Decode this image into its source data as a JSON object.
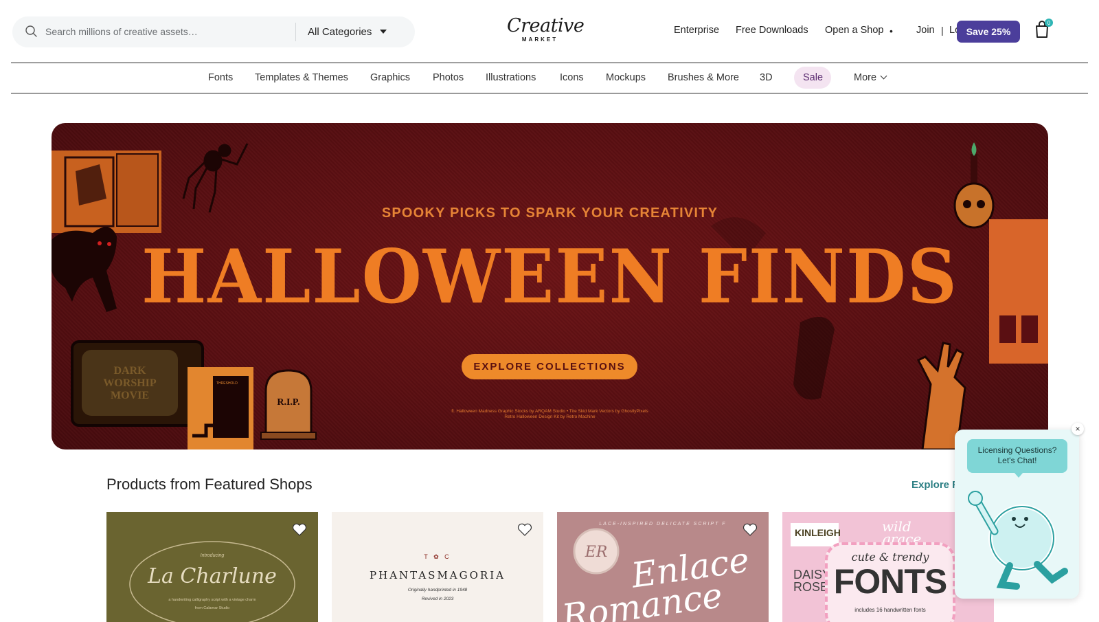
{
  "search": {
    "placeholder": "Search millions of creative assets…",
    "category": "All Categories"
  },
  "logo": {
    "main": "Creative",
    "sub": "MARKET"
  },
  "topnav": {
    "enterprise": "Enterprise",
    "free_downloads": "Free Downloads",
    "open_shop": "Open a Shop",
    "dot": "•",
    "join": "Join",
    "separator": "|",
    "login": "Log in",
    "save": "Save 25%",
    "cart_count": "0"
  },
  "categories": {
    "fonts": "Fonts",
    "templates": "Templates & Themes",
    "graphics": "Graphics",
    "photos": "Photos",
    "illustrations": "Illustrations",
    "icons": "Icons",
    "mockups": "Mockups",
    "brushes": "Brushes & More",
    "three_d": "3D",
    "sale": "Sale",
    "more": "More"
  },
  "hero": {
    "subtitle": "SPOOKY PICKS TO SPARK YOUR CREATIVITY",
    "title": "HALLOWEEN FINDS",
    "button": "EXPLORE COLLECTIONS",
    "credit_line1": "ft. Halloween Madness Graphic Stocks by ARQAM Studio • Tire Skid Mark Vectors by GhostlyPixels",
    "credit_line2": "Retro Halloween Design Kit by Retro Machine",
    "tv_text": "DARK WORSHIP MOVIE",
    "book_text": "THRESHOLD",
    "tomb_text": "R.I.P."
  },
  "featured": {
    "title": "Products from Featured Shops",
    "explore": "Explore F"
  },
  "cards": [
    {
      "intro": "Introducing",
      "name": "La Charlune",
      "desc1": "a handwriting calligraphy script with a vintage charm",
      "desc2": "from Calamar Studio"
    },
    {
      "mark": "T ✿ C",
      "name": "PHANTASMAGORIA",
      "desc1": "Originally handprinted in 1948",
      "desc2": "Revived in 2023"
    },
    {
      "tag": "LACE-INSPIRED DELICATE SCRIPT F",
      "seal": "ER",
      "name1": "Enlace",
      "name2": "Romance"
    },
    {
      "tl": "KINLEIGH",
      "tr": "wild grace",
      "bl1": "DAISY",
      "bl2": "ROSE",
      "small": "cute & trendy",
      "big": "FONTS",
      "foot": "includes 16 handwritten fonts"
    }
  ],
  "chat": {
    "line1": "Licensing Questions?",
    "line2": "Let's Chat!",
    "close": "×"
  },
  "colors": {
    "accent": "#4b3e9b",
    "hero_bg": "#5a0f12",
    "hero_orange": "#ef7d24",
    "sale_pill": "#f4e4f1",
    "link_teal": "#2c7f84",
    "chat_bubble": "#7fd6d6"
  }
}
